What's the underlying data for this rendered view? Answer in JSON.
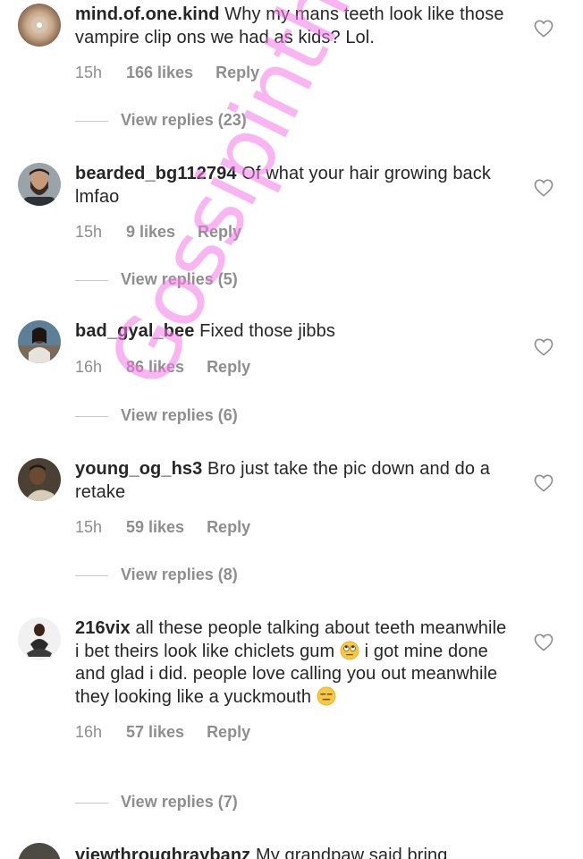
{
  "comments": [
    {
      "username": "mind.of.one.kind",
      "text": "Why my mans teeth look like those vampire clip ons we had as kids? Lol.",
      "time": "15h",
      "likes": "166 likes",
      "reply": "Reply",
      "view_replies": "View replies (23)",
      "avatar": "cd-disc-avatar"
    },
    {
      "username": "bearded_bg112794",
      "text": "Of what your hair growing back lmfao",
      "time": "15h",
      "likes": "9 likes",
      "reply": "Reply",
      "view_replies": "View replies (5)",
      "avatar": "bearded-man-avatar"
    },
    {
      "username": "bad_gyal_bee",
      "text": "Fixed those jibbs",
      "time": "16h",
      "likes": "86 likes",
      "reply": "Reply",
      "view_replies": "View replies (6)",
      "avatar": "woman-photo-avatar"
    },
    {
      "username": "young_og_hs3",
      "text": "Bro just take the pic down and do a retake",
      "time": "15h",
      "likes": "59 likes",
      "reply": "Reply",
      "view_replies": "View replies (8)",
      "avatar": "man-photo-avatar"
    },
    {
      "username": "216vix",
      "text_part1": "all these people talking about teeth meanwhile i bet theirs look like chiclets gum",
      "text_part2": "i got mine done and glad i did. people love calling you out meanwhile they looking like a yuckmouth",
      "emoji1": "rolling-eyes-emoji",
      "emoji2": "expressionless-emoji",
      "time": "16h",
      "likes": "57 likes",
      "reply": "Reply",
      "view_replies": "View replies (7)",
      "avatar": "woman-sitting-avatar"
    }
  ],
  "partial_comment": {
    "username": "viewthroughraybanz",
    "text": "My grandpaw said bring"
  },
  "watermark": "Gossipinthecity",
  "colors": {
    "text": "#262626",
    "meta": "#8e8e8e",
    "watermark": "#f278e6"
  },
  "icons": {
    "like": "heart-outline-icon"
  }
}
